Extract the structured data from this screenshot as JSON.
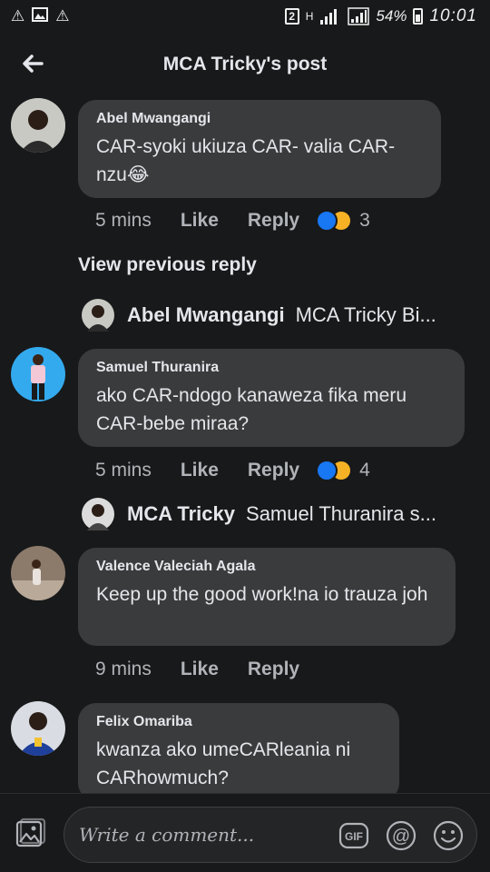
{
  "status_bar": {
    "sim_number": "2",
    "network_type": "H",
    "battery_percent": "54%",
    "time": "10:01"
  },
  "header": {
    "title": "MCA Tricky's post"
  },
  "comments": [
    {
      "author": "Abel Mwangangi",
      "text": "CAR-syoki ukiuza CAR- valia CAR-nzu😂",
      "time": "5 mins",
      "like_label": "Like",
      "reply_label": "Reply",
      "reaction_count": "3"
    },
    {
      "author": "Samuel Thuranira",
      "text": "ako CAR-ndogo kanaweza fika meru CAR-bebe miraa?",
      "time": "5 mins",
      "like_label": "Like",
      "reply_label": "Reply",
      "reaction_count": "4"
    },
    {
      "author": "Valence Valeciah Agala",
      "text": "Keep up the good work!na io trauza joh",
      "time": "9 mins",
      "like_label": "Like",
      "reply_label": "Reply"
    },
    {
      "author": "Felix Omariba",
      "text": "kwanza ako umeCARleania ni CARhowmuch?"
    }
  ],
  "view_previous_reply": "View previous reply",
  "reply_previews": [
    {
      "author": "Abel Mwangangi",
      "snippet": "MCA Tricky Bi..."
    },
    {
      "author": "MCA Tricky",
      "snippet": "Samuel Thuranira s..."
    }
  ],
  "composer": {
    "placeholder": "Write a comment...",
    "gif_label": "GIF"
  },
  "colors": {
    "background": "#18191a",
    "bubble": "#3a3b3c",
    "like_blue": "#1877f2",
    "haha_yellow": "#f7b125"
  }
}
